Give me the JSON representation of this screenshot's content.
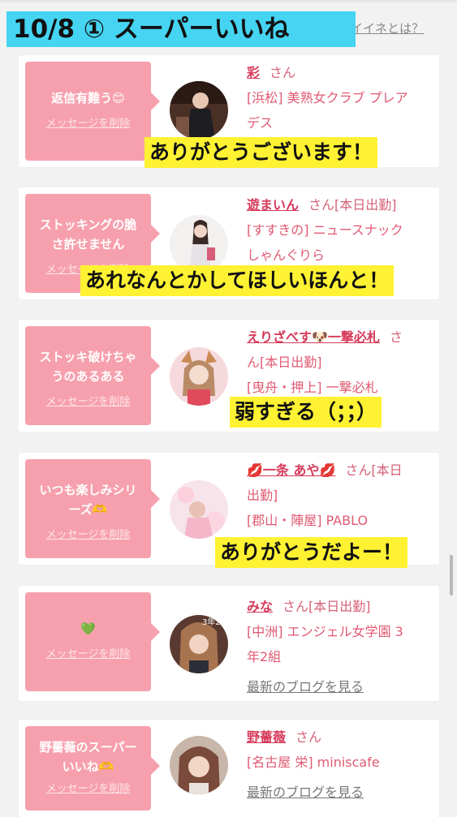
{
  "header": {
    "title": "10/8 ① スーパーいいね",
    "about_link": "イイネとは？"
  },
  "delete_label": "メッセージを削除",
  "blog_label": "最新のブログを見る",
  "cards": [
    {
      "message": "返信有難う😊",
      "name": "彩",
      "honorific": "さん",
      "status": "",
      "shop_line1": "[浜松] 美熟女クラブ プレア",
      "shop_line2": "デス",
      "overlay": "ありがとうございます！"
    },
    {
      "message_line1": "ストッキングの脆",
      "message_line2": "さ許せません",
      "name": "遊まいん",
      "honorific": "さん",
      "status": "[本日出勤]",
      "shop_line1": "[すすきの] ニュースナック",
      "shop_line2": "しゃんぐりら",
      "overlay": "あれなんとかしてほしいほんと！"
    },
    {
      "message_line1": "ストッキ破けちゃ",
      "message_line2": "うのあるある",
      "name": "えりざべす🐶一撃必札",
      "honorific": "さ",
      "name_line2": "ん[本日出勤]",
      "shop_line1": "[曳舟・押上] 一撃必札",
      "overlay": "弱すぎる（；；）"
    },
    {
      "message_line1": "いつも楽しみシリ",
      "message_line2": "ーズ🫶",
      "name": "💋一条 あや💋",
      "honorific": "さん[本日",
      "name_line2": "出勤]",
      "shop_line1": "[郡山・陣屋] PABLO",
      "overlay": "ありがとうだよー！"
    },
    {
      "message": "💚",
      "name": "みな",
      "honorific": "さん[本日出勤]",
      "shop_line1": "[中洲] エンジェル女学園 3",
      "shop_line2": "年2組",
      "avatar_text": "3年2"
    },
    {
      "message_line1": "野薔薇のスーパー",
      "message_line2": "いいね🫶",
      "name": "野薔薇",
      "honorific": "さん",
      "shop_line1": "[名古屋 栄] miniscafe"
    }
  ]
}
